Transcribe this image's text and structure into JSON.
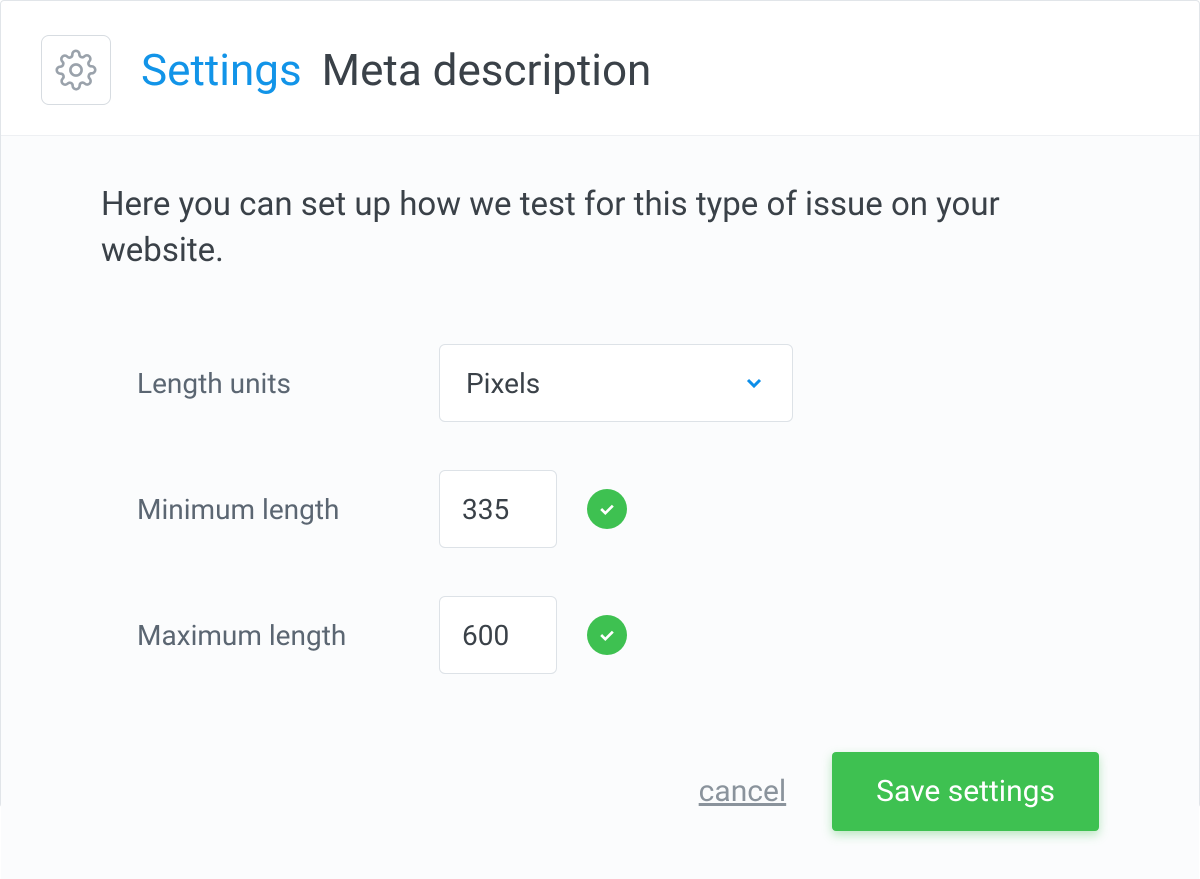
{
  "header": {
    "title_primary": "Settings",
    "title_secondary": "Meta description"
  },
  "description": "Here you can set up how we test for this type of issue on your website.",
  "form": {
    "length_units": {
      "label": "Length units",
      "value": "Pixels"
    },
    "min_length": {
      "label": "Minimum length",
      "value": "335",
      "valid": true
    },
    "max_length": {
      "label": "Maximum length",
      "value": "600",
      "valid": true
    }
  },
  "actions": {
    "cancel_label": "cancel",
    "save_label": "Save settings"
  }
}
